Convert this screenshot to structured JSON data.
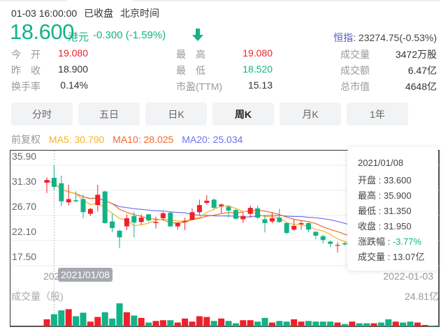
{
  "header": {
    "datetime": "01-03 16:00:00",
    "status": "已收盘",
    "timezone": "北京时间",
    "price": "18.600",
    "currency": "港元",
    "change": "-0.300 (-1.59%)",
    "index_label": "恒指",
    "index_value": ": 23274.75(-0.53%)"
  },
  "stats": [
    {
      "label": "今　开",
      "value": "19.080",
      "color": "red"
    },
    {
      "label": "昨　收",
      "value": "18.900",
      "color": "normal"
    },
    {
      "label": "换手率",
      "value": "0.14%",
      "color": "normal"
    },
    {
      "label": "最　高",
      "value": "19.080",
      "color": "red"
    },
    {
      "label": "最　低",
      "value": "18.520",
      "color": "green"
    },
    {
      "label": "市盈(TTM)",
      "value": "15.13",
      "color": "normal"
    },
    {
      "label": "成交量",
      "value": "3472万股",
      "color": "normal"
    },
    {
      "label": "成交额",
      "value": "6.47亿",
      "color": "normal"
    },
    {
      "label": "总市值",
      "value": "4648亿",
      "color": "normal"
    }
  ],
  "tabs": [
    {
      "label": "分时",
      "active": false
    },
    {
      "label": "五日",
      "active": false
    },
    {
      "label": "日K",
      "active": false
    },
    {
      "label": "周K",
      "active": true
    },
    {
      "label": "月K",
      "active": false
    },
    {
      "label": "1年",
      "active": false
    }
  ],
  "legend": {
    "adjust": "前复权",
    "ma5": "MA5: 30.790",
    "ma10": "MA10: 28.025",
    "ma20": "MA20: 25.034"
  },
  "colors": {
    "up": "#f0202a",
    "down": "#12b386",
    "ma5": "#f5b324",
    "ma10": "#f2682a",
    "ma20": "#6e72ee",
    "index_link": "#4a57c0"
  },
  "tooltip": {
    "date": "2021/01/08",
    "open": "开盘 : 33.600",
    "high": "最高 : 35.900",
    "low": "最低 : 31.350",
    "close": "收盘 : 31.950",
    "change_label": "涨跌幅 : ",
    "change_value": "-3.77%",
    "volume": "成交量 : 13.07亿"
  },
  "chart_data": {
    "type": "candlestick",
    "y_ticks": [
      "35.90",
      "31.30",
      "26.70",
      "22.10",
      "17.50"
    ],
    "ylim": [
      17.5,
      35.9
    ],
    "x_start_label": "202",
    "x_end_label": "2022-01-03",
    "crosshair_label": "2021/01/08",
    "crosshair_index": 1,
    "volume_label": "成交量（股)",
    "volume_max_label": "24.81亿",
    "volume_unit": "亿",
    "volume_max": 24.81,
    "ohlc": [
      [
        32.7,
        33.7,
        30.8,
        33.2
      ],
      [
        33.6,
        35.9,
        31.35,
        31.95
      ],
      [
        32.6,
        34.0,
        28.4,
        29.3
      ],
      [
        29.1,
        32.3,
        28.5,
        29.7
      ],
      [
        29.5,
        31.1,
        29.1,
        29.3
      ],
      [
        29.7,
        30.5,
        26.2,
        27.3
      ],
      [
        27.0,
        28.1,
        26.6,
        27.9
      ],
      [
        28.6,
        32.3,
        27.4,
        30.5
      ],
      [
        31.1,
        31.2,
        25.2,
        25.3
      ],
      [
        25.6,
        27.0,
        23.6,
        24.4
      ],
      [
        23.9,
        24.1,
        20.7,
        22.7
      ],
      [
        24.7,
        26.9,
        24.0,
        26.2
      ],
      [
        26.6,
        27.4,
        22.7,
        25.4
      ],
      [
        25.5,
        26.9,
        25.0,
        26.3
      ],
      [
        26.9,
        27.0,
        25.5,
        25.8
      ],
      [
        25.3,
        26.5,
        24.3,
        25.5
      ],
      [
        26.2,
        27.4,
        25.8,
        27.1
      ],
      [
        27.2,
        27.4,
        24.6,
        24.7
      ],
      [
        24.7,
        25.4,
        24.1,
        25.3
      ],
      [
        25.5,
        26.3,
        24.0,
        25.7
      ],
      [
        25.9,
        28.0,
        25.8,
        27.3
      ],
      [
        27.3,
        29.6,
        26.8,
        28.6
      ],
      [
        29.0,
        30.4,
        28.7,
        29.4
      ],
      [
        29.6,
        29.8,
        27.8,
        28.1
      ],
      [
        28.4,
        28.9,
        27.1,
        28.7
      ],
      [
        28.3,
        28.6,
        26.3,
        27.6
      ],
      [
        27.7,
        27.9,
        26.0,
        26.1
      ],
      [
        26.0,
        27.2,
        25.3,
        26.6
      ],
      [
        27.0,
        28.5,
        26.3,
        28.1
      ],
      [
        28.0,
        28.5,
        26.0,
        26.3
      ],
      [
        26.0,
        26.7,
        23.6,
        25.3
      ],
      [
        25.6,
        27.2,
        25.3,
        26.2
      ],
      [
        26.3,
        27.9,
        25.3,
        25.5
      ],
      [
        25.3,
        25.4,
        23.2,
        23.5
      ],
      [
        24.1,
        26.0,
        23.9,
        24.8
      ],
      [
        25.1,
        25.8,
        24.1,
        25.3
      ],
      [
        25.3,
        25.4,
        23.6,
        24.1
      ],
      [
        23.7,
        23.8,
        22.4,
        23.0
      ],
      [
        22.9,
        23.2,
        21.6,
        22.2
      ],
      [
        21.9,
        22.1,
        20.9,
        21.5
      ],
      [
        21.2,
        21.8,
        19.9,
        21.3
      ],
      [
        21.6,
        21.8,
        21.2,
        21.4
      ],
      [
        21.0,
        21.8,
        20.6,
        21.4
      ],
      [
        21.4,
        21.6,
        20.3,
        20.6
      ],
      [
        20.6,
        20.9,
        19.6,
        20.0
      ],
      [
        20.0,
        20.9,
        19.8,
        20.5
      ],
      [
        20.5,
        20.7,
        19.5,
        19.8
      ],
      [
        19.8,
        20.0,
        18.9,
        19.2
      ],
      [
        19.2,
        20.0,
        19.0,
        19.6
      ],
      [
        19.6,
        19.8,
        18.7,
        19.0
      ],
      [
        19.0,
        19.2,
        18.3,
        18.7
      ],
      [
        18.7,
        19.3,
        18.5,
        19.0
      ],
      [
        18.8,
        19.2,
        18.6,
        18.9
      ],
      [
        19.08,
        19.08,
        18.52,
        18.6
      ]
    ],
    "volume": [
      7.6,
      13.07,
      17.2,
      18.5,
      10.9,
      14.7,
      5.1,
      10.1,
      15.2,
      8.4,
      24.81,
      15.2,
      11.6,
      9.1,
      4.1,
      5.8,
      6.6,
      6.6,
      4.1,
      8.4,
      5.1,
      10.9,
      10.1,
      5.8,
      8.4,
      5.8,
      3.3,
      6.6,
      6.6,
      5.1,
      9.1,
      4.1,
      5.8,
      5.1,
      7.6,
      5.1,
      5.8,
      5.1,
      5.1,
      5.1,
      4.1,
      2.5,
      5.1,
      3.3,
      3.3,
      3.3,
      4.1,
      7.6,
      5.1,
      4.1,
      5.1,
      4.1,
      1.5,
      0.8
    ]
  }
}
